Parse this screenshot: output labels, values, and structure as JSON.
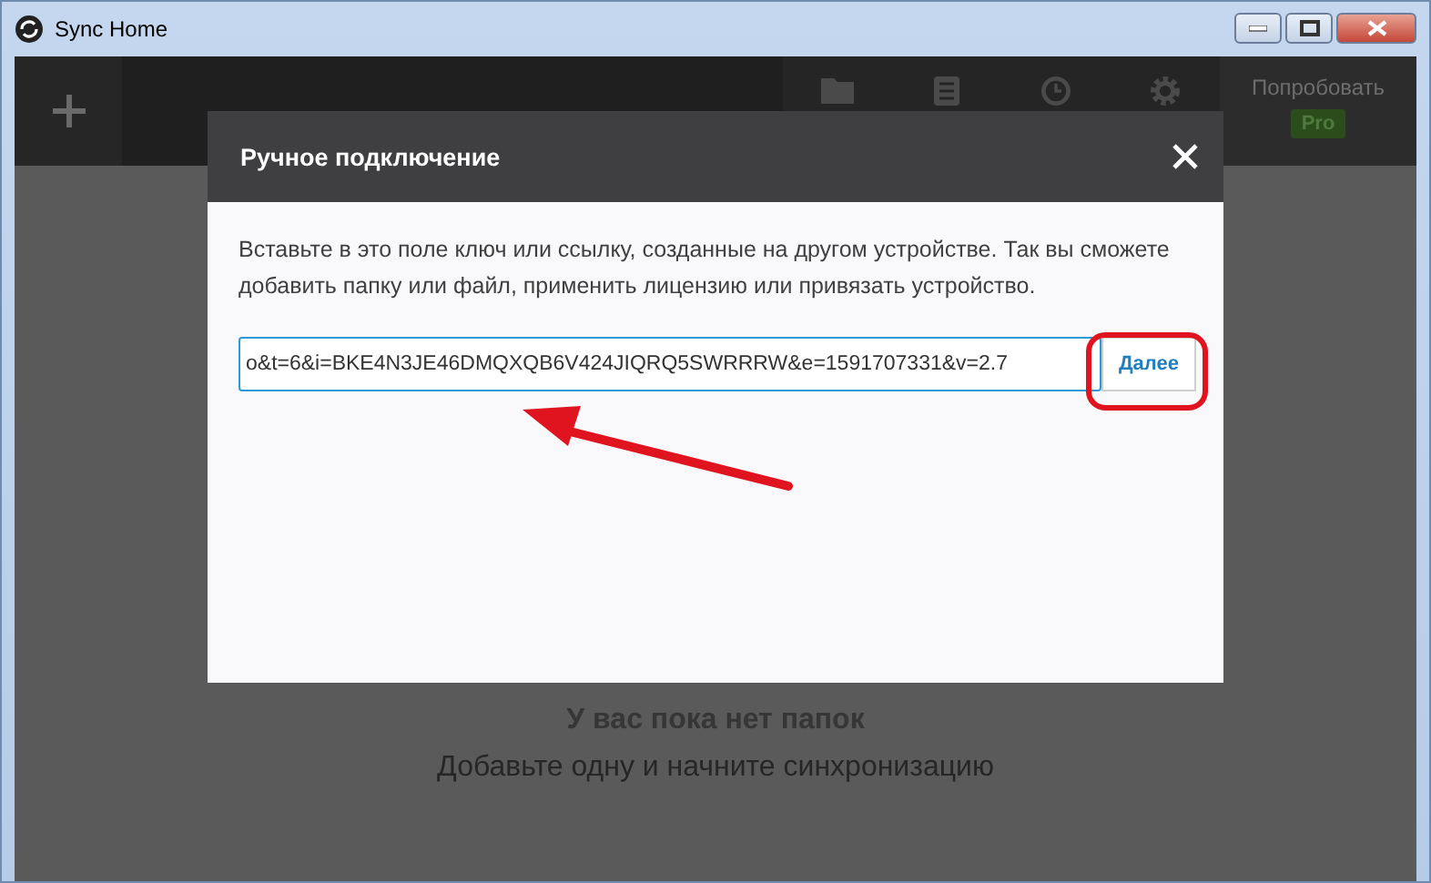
{
  "window": {
    "title": "Sync Home"
  },
  "toolbar": {
    "promo_label": "Попробовать",
    "promo_badge": "Pro"
  },
  "empty_state": {
    "title": "У вас пока нет папок",
    "subtitle": "Добавьте одну и начните синхронизацию"
  },
  "dialog": {
    "title": "Ручное подключение",
    "description": "Вставьте в это поле ключ или ссылку, созданные на другом устройстве. Так вы сможете добавить папку или файл, применить лицензию или привязать устройство.",
    "link_field": {
      "value": "o&t=6&i=BKE4N3JE46DMQXQB6V424JIQRQ5SWRRRW&e=1591707331&v=2.7"
    },
    "next_button": "Далее"
  }
}
